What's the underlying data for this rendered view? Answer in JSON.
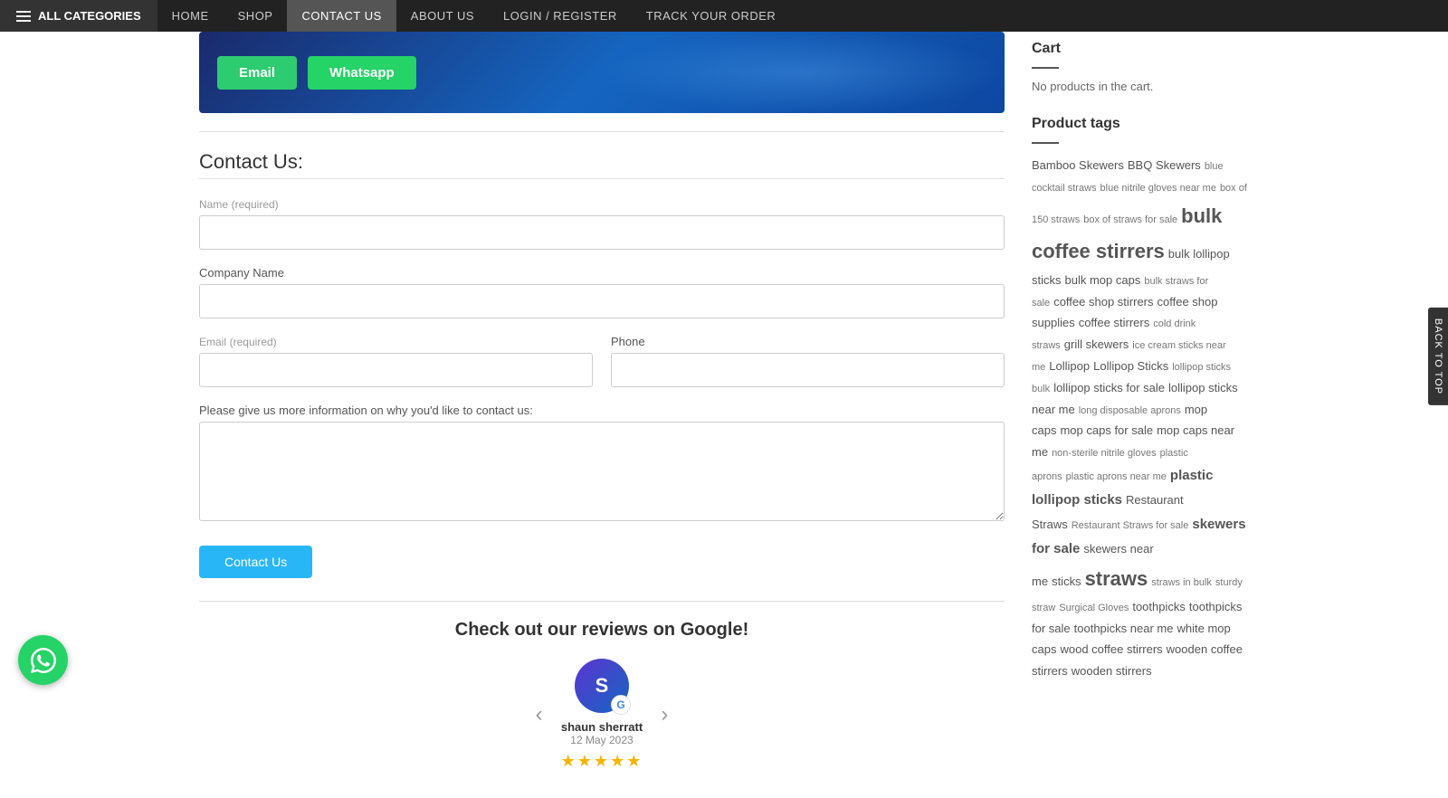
{
  "nav": {
    "all_categories": "ALL CATEGORIES",
    "links": [
      {
        "label": "HOME",
        "href": "#",
        "active": false
      },
      {
        "label": "SHOP",
        "href": "#",
        "active": false
      },
      {
        "label": "CONTACT US",
        "href": "#",
        "active": true
      },
      {
        "label": "ABOUT US",
        "href": "#",
        "active": false
      },
      {
        "label": "LOGIN / REGISTER",
        "href": "#",
        "active": false
      },
      {
        "label": "TRACK YOUR ORDER",
        "href": "#",
        "active": false
      }
    ]
  },
  "buttons": {
    "email": "Email",
    "whatsapp": "Whatsapp",
    "contact_us": "Contact Us"
  },
  "contact_form": {
    "title": "Contact Us:",
    "name_label": "Name",
    "name_required": "(required)",
    "company_label": "Company Name",
    "email_label": "Email",
    "email_required": "(required)",
    "phone_label": "Phone",
    "message_label": "Please give us more information on why you'd like to contact us:"
  },
  "reviews": {
    "title": "Check out our reviews on Google!",
    "reviewer": {
      "initials": "S",
      "google_letter": "G",
      "name": "shaun sherratt",
      "date": "12 May 2023",
      "stars": "★★★★★"
    }
  },
  "sidebar": {
    "cart_title": "Cart",
    "cart_empty": "No products in the cart.",
    "product_tags_title": "Product tags",
    "tags": [
      {
        "label": "Bamboo Skewers",
        "size": "normal"
      },
      {
        "label": "BBQ Skewers",
        "size": "normal"
      },
      {
        "label": "blue cocktail straws",
        "size": "small"
      },
      {
        "label": "blue nitrile gloves near me",
        "size": "small"
      },
      {
        "label": "box of 150 straws",
        "size": "small"
      },
      {
        "label": "box of straws for sale",
        "size": "small"
      },
      {
        "label": "bulk coffee stirrers",
        "size": "large"
      },
      {
        "label": "bulk lollipop sticks",
        "size": "normal"
      },
      {
        "label": "bulk mop caps",
        "size": "normal"
      },
      {
        "label": "bulk straws for sale",
        "size": "small"
      },
      {
        "label": "coffee shop stirrers",
        "size": "normal"
      },
      {
        "label": "coffee shop supplies",
        "size": "normal"
      },
      {
        "label": "coffee stirrers",
        "size": "normal"
      },
      {
        "label": "cold drink straws",
        "size": "small"
      },
      {
        "label": "grill skewers",
        "size": "normal"
      },
      {
        "label": "ice cream sticks near me",
        "size": "small"
      },
      {
        "label": "Lollipop",
        "size": "normal"
      },
      {
        "label": "Lollipop Sticks",
        "size": "normal"
      },
      {
        "label": "lollipop sticks bulk",
        "size": "small"
      },
      {
        "label": "lollipop sticks for sale",
        "size": "normal"
      },
      {
        "label": "lollipop sticks near me",
        "size": "normal"
      },
      {
        "label": "long disposable aprons",
        "size": "small"
      },
      {
        "label": "mop caps",
        "size": "normal"
      },
      {
        "label": "mop caps for sale",
        "size": "normal"
      },
      {
        "label": "mop caps near me",
        "size": "normal"
      },
      {
        "label": "non-sterile nitrile gloves",
        "size": "small"
      },
      {
        "label": "plastic aprons",
        "size": "small"
      },
      {
        "label": "plastic aprons near me",
        "size": "small"
      },
      {
        "label": "plastic lollipop sticks",
        "size": "bold"
      },
      {
        "label": "Restaurant Straws",
        "size": "normal"
      },
      {
        "label": "Restaurant Straws for sale",
        "size": "small"
      },
      {
        "label": "skewers for sale",
        "size": "bold"
      },
      {
        "label": "skewers near me",
        "size": "normal"
      },
      {
        "label": "sticks",
        "size": "normal"
      },
      {
        "label": "straws",
        "size": "large"
      },
      {
        "label": "straws in bulk",
        "size": "small"
      },
      {
        "label": "sturdy straw",
        "size": "small"
      },
      {
        "label": "Surgical Gloves",
        "size": "small"
      },
      {
        "label": "toothpicks",
        "size": "normal"
      },
      {
        "label": "toothpicks for sale",
        "size": "normal"
      },
      {
        "label": "toothpicks near me",
        "size": "normal"
      },
      {
        "label": "white mop caps",
        "size": "normal"
      },
      {
        "label": "wood coffee stirrers",
        "size": "normal"
      },
      {
        "label": "wooden coffee stirrers",
        "size": "normal"
      },
      {
        "label": "wooden stirrers",
        "size": "normal"
      }
    ]
  },
  "back_to_top": "BACK TO TOP"
}
